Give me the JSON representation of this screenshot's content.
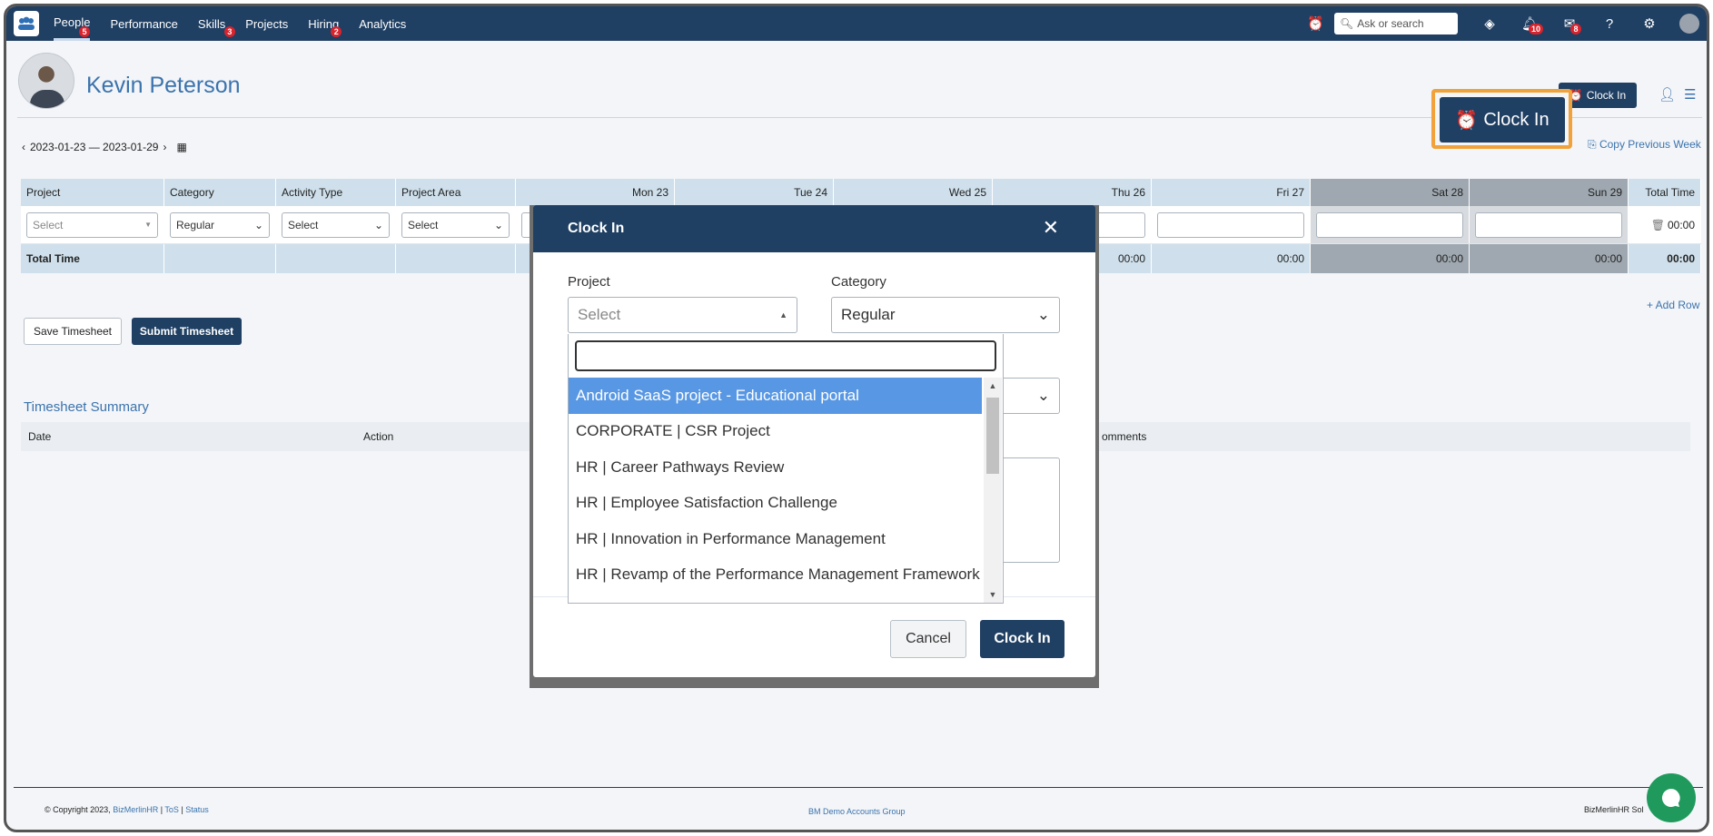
{
  "nav": {
    "items": [
      {
        "label": "People",
        "badge": "5"
      },
      {
        "label": "Performance",
        "badge": ""
      },
      {
        "label": "Skills",
        "badge": "3"
      },
      {
        "label": "Projects",
        "badge": ""
      },
      {
        "label": "Hiring",
        "badge": "2"
      },
      {
        "label": "Analytics",
        "badge": ""
      }
    ],
    "search_placeholder": "Ask or search",
    "notification_badge": "10",
    "mail_badge": "8"
  },
  "profile": {
    "name": "Kevin Peterson",
    "clock_in_label": "Clock In",
    "clock_in_highlight_label": "Clock In"
  },
  "timesheet": {
    "date_range": "2023-01-23 — 2023-01-29",
    "copy_previous_week": "Copy Previous Week",
    "columns": [
      "Project",
      "Category",
      "Activity Type",
      "Project Area",
      "Mon 23",
      "Tue 24",
      "Wed 25",
      "Thu 26",
      "Fri 27",
      "Sat 28",
      "Sun 29",
      "Total Time"
    ],
    "row": {
      "project": "Select",
      "category": "Regular",
      "activity_type": "Select",
      "project_area": "Select",
      "total": "00:00"
    },
    "total_row": {
      "label": "Total Time",
      "thu": "00:00",
      "fri": "00:00",
      "sat": "00:00",
      "sun": "00:00",
      "total": "00:00"
    },
    "add_row": "+ Add Row",
    "save_button": "Save Timesheet",
    "submit_button": "Submit Timesheet"
  },
  "summary": {
    "title": "Timesheet Summary",
    "columns": [
      "Date",
      "Action",
      "Comments"
    ],
    "comments_visible": "omments"
  },
  "modal": {
    "title": "Clock In",
    "project_label": "Project",
    "project_value": "Select",
    "category_label": "Category",
    "category_value": "Regular",
    "cancel_button": "Cancel",
    "clock_in_button": "Clock In",
    "dropdown_options": [
      "Android SaaS project - Educational portal",
      "CORPORATE | CSR Project",
      "HR | Career Pathways Review",
      "HR | Employee Satisfaction Challenge",
      "HR | Innovation in Performance Management",
      "HR | Revamp of the Performance Management Framework"
    ]
  },
  "footer": {
    "copyright": "© Copyright 2023,",
    "company_link": "BizMerlinHR",
    "tos": "ToS",
    "status": "Status",
    "center": "BM Demo Accounts Group",
    "right": "BizMerlinHR Sol"
  },
  "colors": {
    "primary": "#1f3f63",
    "accent_link": "#3b73ad",
    "highlight": "#f2a23a",
    "badge": "#d9232d",
    "selected_option": "#5897e3",
    "chat": "#1f9a5c"
  }
}
